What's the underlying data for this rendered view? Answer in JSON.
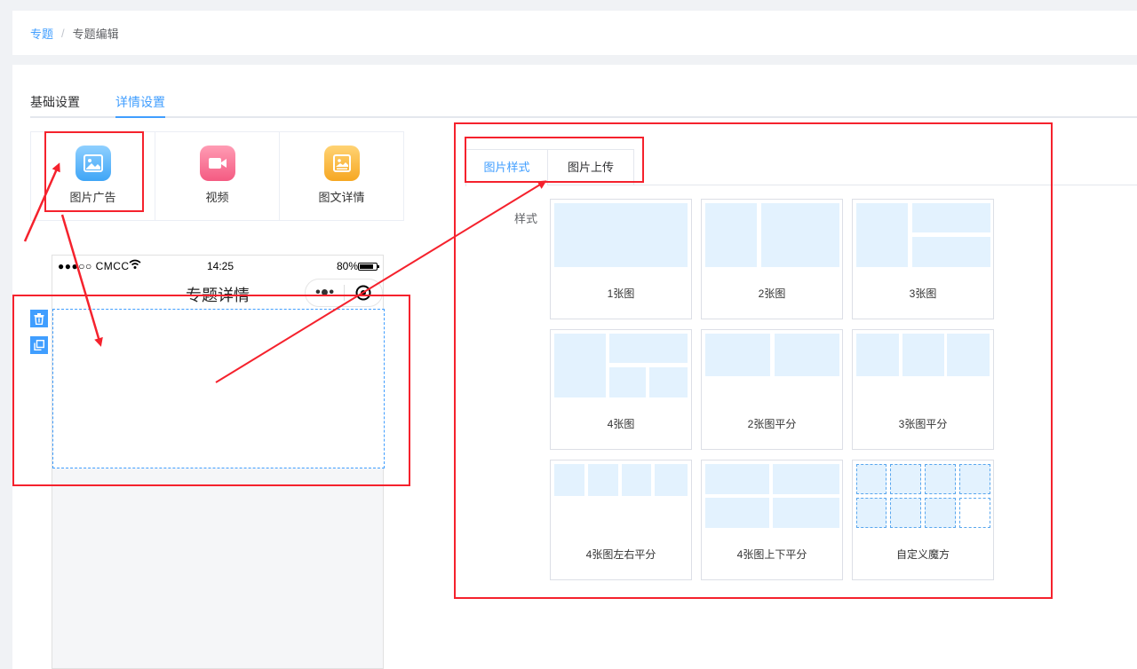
{
  "breadcrumb": {
    "root": "专题",
    "separator": "/",
    "current": "专题编辑"
  },
  "tabs": [
    {
      "label": "基础设置",
      "active": false
    },
    {
      "label": "详情设置",
      "active": true
    }
  ],
  "components": [
    {
      "label": "图片广告",
      "icon": "image-icon"
    },
    {
      "label": "视频",
      "icon": "video-camera-icon"
    },
    {
      "label": "图文详情",
      "icon": "image-text-icon"
    }
  ],
  "phone": {
    "carrier": "●●●○○ CMCC",
    "time": "14:25",
    "battery": "80%",
    "title": "专题详情",
    "more": "•●•"
  },
  "style_panel": {
    "tabs": [
      {
        "label": "图片样式",
        "active": true
      },
      {
        "label": "图片上传",
        "active": false
      }
    ],
    "label": "样式",
    "layouts": [
      {
        "name": "1张图"
      },
      {
        "name": "2张图"
      },
      {
        "name": "3张图"
      },
      {
        "name": "4张图"
      },
      {
        "name": "2张图平分"
      },
      {
        "name": "3张图平分"
      },
      {
        "name": "4张图左右平分"
      },
      {
        "name": "4张图上下平分"
      },
      {
        "name": "自定义魔方"
      }
    ]
  },
  "colors": {
    "accent": "#409eff",
    "annotation": "#f5222d",
    "placeholder": "#e3f2fe"
  }
}
